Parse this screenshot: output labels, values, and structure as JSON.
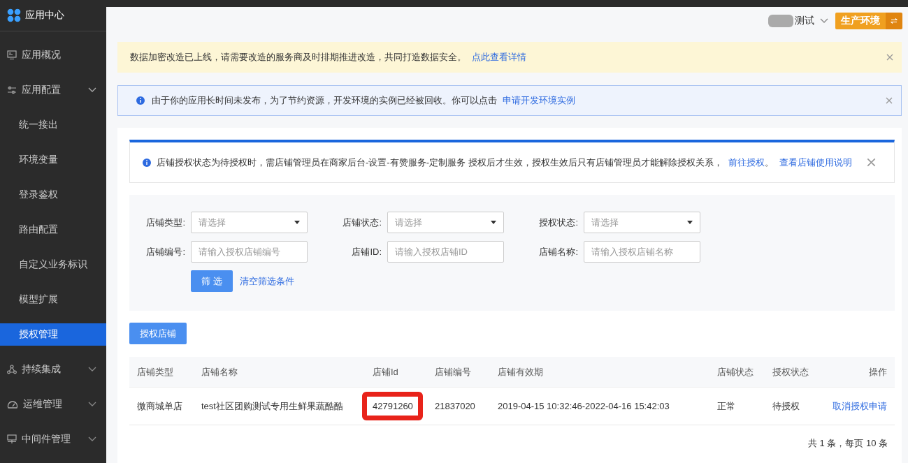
{
  "sidebar": {
    "title": "应用中心",
    "items": [
      {
        "label": "应用概况",
        "selected": false
      },
      {
        "label": "应用配置",
        "selected": false,
        "expanded": true,
        "children": [
          {
            "label": "统一接出",
            "selected": false
          },
          {
            "label": "环境变量",
            "selected": false
          },
          {
            "label": "登录鉴权",
            "selected": false
          },
          {
            "label": "路由配置",
            "selected": false
          },
          {
            "label": "自定义业务标识",
            "selected": false
          },
          {
            "label": "模型扩展",
            "selected": false
          },
          {
            "label": "授权管理",
            "selected": true
          }
        ]
      },
      {
        "label": "持续集成",
        "selected": false,
        "expanded": false
      },
      {
        "label": "运维管理",
        "selected": false,
        "expanded": false
      },
      {
        "label": "中间件管理",
        "selected": false,
        "expanded": false
      }
    ]
  },
  "header": {
    "user": "测试",
    "environment": "生产环境"
  },
  "notices": [
    {
      "kind": "warning",
      "text": "数据加密改造已上线，请需要改造的服务商及时排期推进改造，共同打造数据安全。",
      "link": "点此查看详情"
    },
    {
      "kind": "info",
      "text": "由于你的应用长时间未发布，为了节约资源，开发环境的实例已经被回收。你可以点击",
      "link": "申请开发环境实例"
    }
  ],
  "alert": {
    "segments": [
      {
        "kind": "text",
        "text": "店铺授权状态为待授权时，需店铺管理员在商家后台-设置-有赞服务-定制服务 授权后才生效，授权生效后只有店铺管理员才能解除授权关系，"
      },
      {
        "kind": "link",
        "text": "前往授权"
      },
      {
        "kind": "text",
        "text": "。"
      },
      {
        "kind": "link",
        "text": "查看店铺使用说明"
      }
    ]
  },
  "filters": [
    {
      "kind": "select",
      "label": "店铺类型:",
      "placeholder": "请选择"
    },
    {
      "kind": "select",
      "label": "店铺状态:",
      "placeholder": "请选择"
    },
    {
      "kind": "select",
      "label": "授权状态:",
      "placeholder": "请选择"
    },
    {
      "kind": "input",
      "label": "店铺编号:",
      "placeholder": "请输入授权店铺编号"
    },
    {
      "kind": "input",
      "label": "店铺ID:",
      "placeholder": "请输入授权店铺ID"
    },
    {
      "kind": "input",
      "label": "店铺名称:",
      "placeholder": "请输入授权店铺名称"
    }
  ],
  "filter_button": "筛 选",
  "clear_link": "清空筛选条件",
  "add_button": "授权店铺",
  "table": {
    "columns": [
      "店铺类型",
      "店铺名称",
      "店铺Id",
      "店铺编号",
      "店铺有效期",
      "店铺状态",
      "授权状态",
      "操作"
    ],
    "rows": [
      {
        "cells": [
          {
            "kind": "text",
            "text": "微商城单店",
            "highlighted": false
          },
          {
            "kind": "text",
            "text": "test社区团购测试专用生鲜果蔬酷酷",
            "highlighted": false
          },
          {
            "kind": "text",
            "text": "42791260",
            "highlighted": true
          },
          {
            "kind": "text",
            "text": "21837020",
            "highlighted": false
          },
          {
            "kind": "text",
            "text": "2019-04-15 10:32:46-2022-04-16 15:42:03",
            "highlighted": false
          },
          {
            "kind": "text",
            "text": "正常",
            "highlighted": false
          },
          {
            "kind": "text",
            "text": "待授权",
            "highlighted": false
          },
          {
            "kind": "link",
            "text": "取消授权申请",
            "highlighted": false
          }
        ]
      }
    ]
  },
  "pagination": "共 1 条，每页 10 条"
}
